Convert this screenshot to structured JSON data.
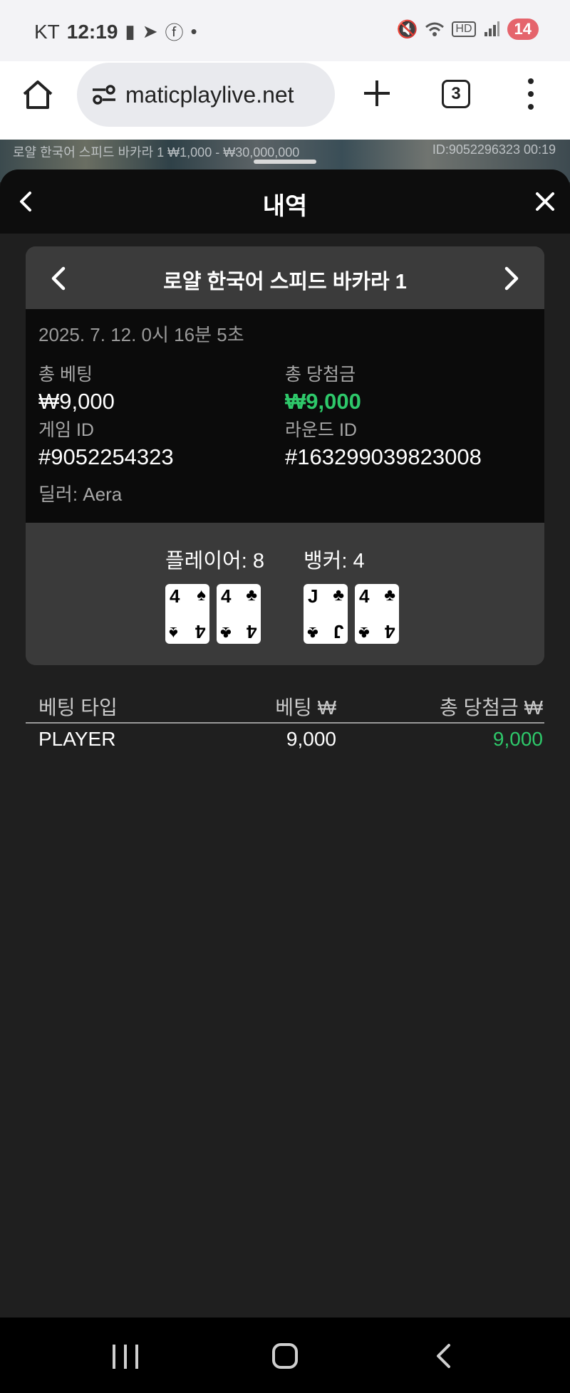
{
  "status": {
    "carrier": "KT",
    "time": "12:19",
    "hd_label": "HD",
    "battery": "14",
    "icons": [
      "battery-alert-icon",
      "telegram-icon",
      "facebook-icon",
      "dot-icon",
      "mute-icon",
      "wifi-icon",
      "signal-icon"
    ]
  },
  "browser": {
    "url": "maticplaylive.net",
    "tab_count": "3",
    "icons": [
      "home-icon",
      "site-settings-icon",
      "new-tab-icon",
      "menu-dots-icon"
    ]
  },
  "backdrop": {
    "table_info": "로얄 한국어 스피드 바카라 1  ₩1,000 - ₩30,000,000",
    "id_info": "ID:9052296323  00:19"
  },
  "panel": {
    "title": "내역",
    "game_name": "로얄 한국어 스피드 바카라 1",
    "datetime": "2025. 7. 12. 0시 16분 5초",
    "total_bet_label": "총 베팅",
    "total_bet_value": "₩9,000",
    "total_win_label": "총 당첨금",
    "total_win_value": "₩9,000",
    "game_id_label": "게임 ID",
    "game_id_value": "#9052254323",
    "round_id_label": "라운드 ID",
    "round_id_value": "#163299039823008",
    "dealer": "딜러: Aera",
    "accent_color": "#2ec86a"
  },
  "result": {
    "player_label": "플레이어: 8",
    "banker_label": "뱅커: 4",
    "player_cards": [
      {
        "rank": "4",
        "suit": "♠"
      },
      {
        "rank": "4",
        "suit": "♣"
      }
    ],
    "banker_cards": [
      {
        "rank": "J",
        "suit": "♣"
      },
      {
        "rank": "4",
        "suit": "♣"
      }
    ]
  },
  "bets": {
    "headers": [
      "베팅 타입",
      "베팅 ₩",
      "총 당첨금 ₩"
    ],
    "rows": [
      {
        "type": "PLAYER",
        "bet": "9,000",
        "win": "9,000"
      }
    ]
  }
}
